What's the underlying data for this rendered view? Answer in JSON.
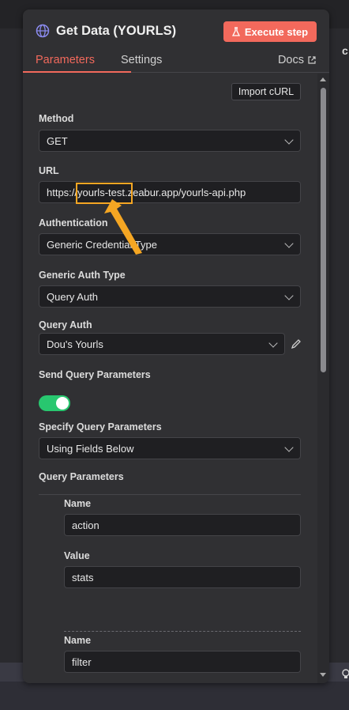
{
  "background": {
    "right_text": "c",
    "right_icon": "lightbulb-icon"
  },
  "header": {
    "title": "Get Data (YOURLS)",
    "execute_label": "Execute step",
    "execute_icon": "flask-icon",
    "globe_icon": "globe-icon"
  },
  "tabs": {
    "parameters": "Parameters",
    "settings": "Settings",
    "docs": "Docs"
  },
  "form": {
    "import_label": "Import cURL",
    "method_label": "Method",
    "method_value": "GET",
    "url_label": "URL",
    "url_value": "https://yourls-test.zeabur.app/yourls-api.php",
    "auth_label": "Authentication",
    "auth_value": "Generic Credential Type",
    "generic_auth_label": "Generic Auth Type",
    "generic_auth_value": "Query Auth",
    "query_auth_label": "Query Auth",
    "query_auth_value": "Dou's Yourls",
    "send_query_label": "Send Query Parameters",
    "send_query_enabled": true,
    "specify_label": "Specify Query Parameters",
    "specify_value": "Using Fields Below",
    "query_params_label": "Query Parameters",
    "params": [
      {
        "name_label": "Name",
        "name_value": "action",
        "value_label": "Value",
        "value_value": "stats"
      },
      {
        "name_label": "Name",
        "name_value": "filter"
      }
    ]
  },
  "colors": {
    "accent": "#f2695c",
    "toggle_on": "#28c76f",
    "highlight": "#f5a623"
  }
}
